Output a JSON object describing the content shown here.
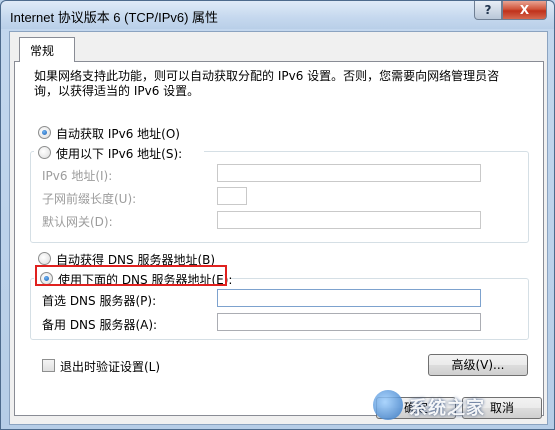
{
  "window": {
    "title": "Internet 协议版本 6 (TCP/IPv6) 属性",
    "help_label": "?",
    "close_label": "X"
  },
  "tabs": [
    {
      "label": "常规",
      "selected": true
    }
  ],
  "description": {
    "line1": "如果网络支持此功能，则可以自动获取分配的 IPv6 设置。否则，您需要向网络管理员咨",
    "line2": "询，以获得适当的 IPv6 设置。"
  },
  "ip_section": {
    "auto_option": {
      "label": "自动获取 IPv6 地址(O)",
      "checked": true
    },
    "manual_option": {
      "label": "使用以下 IPv6 地址(S):",
      "checked": false
    },
    "fields": [
      {
        "label": "IPv6 地址(I):",
        "value": ""
      },
      {
        "label": "子网前缀长度(U):",
        "value": ""
      },
      {
        "label": "默认网关(D):",
        "value": ""
      }
    ]
  },
  "dns_section": {
    "auto_option": {
      "label": "自动获得 DNS 服务器地址(B)",
      "checked": false
    },
    "manual_option": {
      "label": "使用下面的 DNS 服务器地址(E):",
      "checked": true
    },
    "fields": [
      {
        "label": "首选 DNS 服务器(P):",
        "value": ""
      },
      {
        "label": "备用 DNS 服务器(A):",
        "value": ""
      }
    ]
  },
  "validate_checkbox": {
    "label": "退出时验证设置(L)",
    "checked": false
  },
  "buttons": {
    "advanced": "高级(V)...",
    "ok": "确定",
    "cancel": "取消"
  },
  "watermark": {
    "text": "系统之家"
  },
  "colors": {
    "highlight_border": "#e0211f",
    "accent": "#1c5fb0"
  }
}
